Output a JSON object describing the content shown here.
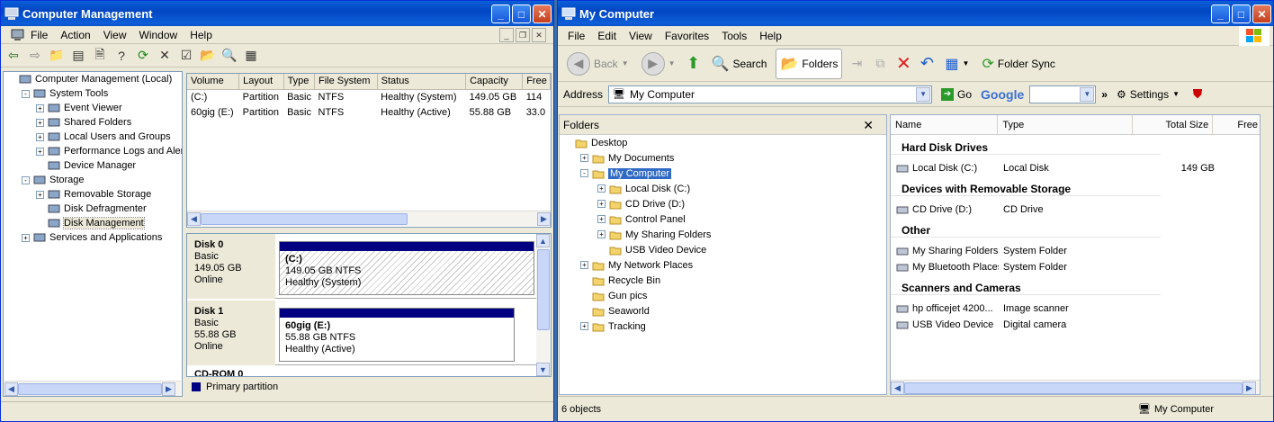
{
  "cm": {
    "title": "Computer Management",
    "menu": [
      "File",
      "Action",
      "View",
      "Window",
      "Help"
    ],
    "tree": [
      {
        "label": "Computer Management (Local)",
        "level": 0,
        "exp": ""
      },
      {
        "label": "System Tools",
        "level": 1,
        "exp": "−"
      },
      {
        "label": "Event Viewer",
        "level": 2,
        "exp": "+"
      },
      {
        "label": "Shared Folders",
        "level": 2,
        "exp": "+"
      },
      {
        "label": "Local Users and Groups",
        "level": 2,
        "exp": "+"
      },
      {
        "label": "Performance Logs and Alerts",
        "level": 2,
        "exp": "+"
      },
      {
        "label": "Device Manager",
        "level": 2,
        "exp": ""
      },
      {
        "label": "Storage",
        "level": 1,
        "exp": "−"
      },
      {
        "label": "Removable Storage",
        "level": 2,
        "exp": "+"
      },
      {
        "label": "Disk Defragmenter",
        "level": 2,
        "exp": ""
      },
      {
        "label": "Disk Management",
        "level": 2,
        "exp": "",
        "selected": true
      },
      {
        "label": "Services and Applications",
        "level": 1,
        "exp": "+"
      }
    ],
    "volume_headers": [
      "Volume",
      "Layout",
      "Type",
      "File System",
      "Status",
      "Capacity",
      "Free"
    ],
    "volumes": [
      [
        "(C:)",
        "Partition",
        "Basic",
        "NTFS",
        "Healthy (System)",
        "149.05 GB",
        "114"
      ],
      [
        "60gig (E:)",
        "Partition",
        "Basic",
        "NTFS",
        "Healthy (Active)",
        "55.88 GB",
        "33.0"
      ]
    ],
    "disks": [
      {
        "name": "Disk 0",
        "type": "Basic",
        "size": "149.05 GB",
        "state": "Online",
        "part_name": "(C:)",
        "part_size": "149.05 GB NTFS",
        "part_status": "Healthy (System)"
      },
      {
        "name": "Disk 1",
        "type": "Basic",
        "size": "55.88 GB",
        "state": "Online",
        "part_name": "60gig  (E:)",
        "part_size": "55.88 GB NTFS",
        "part_status": "Healthy (Active)"
      }
    ],
    "cdrom": "CD-ROM 0",
    "legend": "Primary partition"
  },
  "mc": {
    "title": "My Computer",
    "menu": [
      "File",
      "Edit",
      "View",
      "Favorites",
      "Tools",
      "Help"
    ],
    "toolbar": {
      "back": "Back",
      "search": "Search",
      "folders": "Folders",
      "folder_sync": "Folder Sync"
    },
    "address_label": "Address",
    "address_value": "My Computer",
    "go": "Go",
    "google": "Google",
    "settings": "Settings",
    "folders_title": "Folders",
    "folder_tree": [
      {
        "label": "Desktop",
        "level": 0,
        "exp": ""
      },
      {
        "label": "My Documents",
        "level": 1,
        "exp": "+"
      },
      {
        "label": "My Computer",
        "level": 1,
        "exp": "−",
        "selected": true
      },
      {
        "label": "Local Disk (C:)",
        "level": 2,
        "exp": "+"
      },
      {
        "label": "CD Drive (D:)",
        "level": 2,
        "exp": "+"
      },
      {
        "label": "Control Panel",
        "level": 2,
        "exp": "+"
      },
      {
        "label": "My Sharing Folders",
        "level": 2,
        "exp": "+"
      },
      {
        "label": "USB Video Device",
        "level": 2,
        "exp": ""
      },
      {
        "label": "My Network Places",
        "level": 1,
        "exp": "+"
      },
      {
        "label": "Recycle Bin",
        "level": 1,
        "exp": ""
      },
      {
        "label": "Gun pics",
        "level": 1,
        "exp": ""
      },
      {
        "label": "Seaworld",
        "level": 1,
        "exp": ""
      },
      {
        "label": "Tracking",
        "level": 1,
        "exp": "+"
      }
    ],
    "list_headers": [
      "Name",
      "Type",
      "Total Size",
      "Free"
    ],
    "groups": [
      {
        "title": "Hard Disk Drives",
        "items": [
          [
            "Local Disk (C:)",
            "Local Disk",
            "149 GB"
          ]
        ]
      },
      {
        "title": "Devices with Removable Storage",
        "items": [
          [
            "CD Drive (D:)",
            "CD Drive",
            ""
          ]
        ]
      },
      {
        "title": "Other",
        "items": [
          [
            "My Sharing Folders",
            "System Folder",
            ""
          ],
          [
            "My Bluetooth Places",
            "System Folder",
            ""
          ]
        ]
      },
      {
        "title": "Scanners and Cameras",
        "items": [
          [
            "hp officejet 4200...",
            "Image scanner",
            ""
          ],
          [
            "USB Video Device",
            "Digital camera",
            ""
          ]
        ]
      }
    ],
    "status_left": "6 objects",
    "status_right": "My Computer"
  }
}
